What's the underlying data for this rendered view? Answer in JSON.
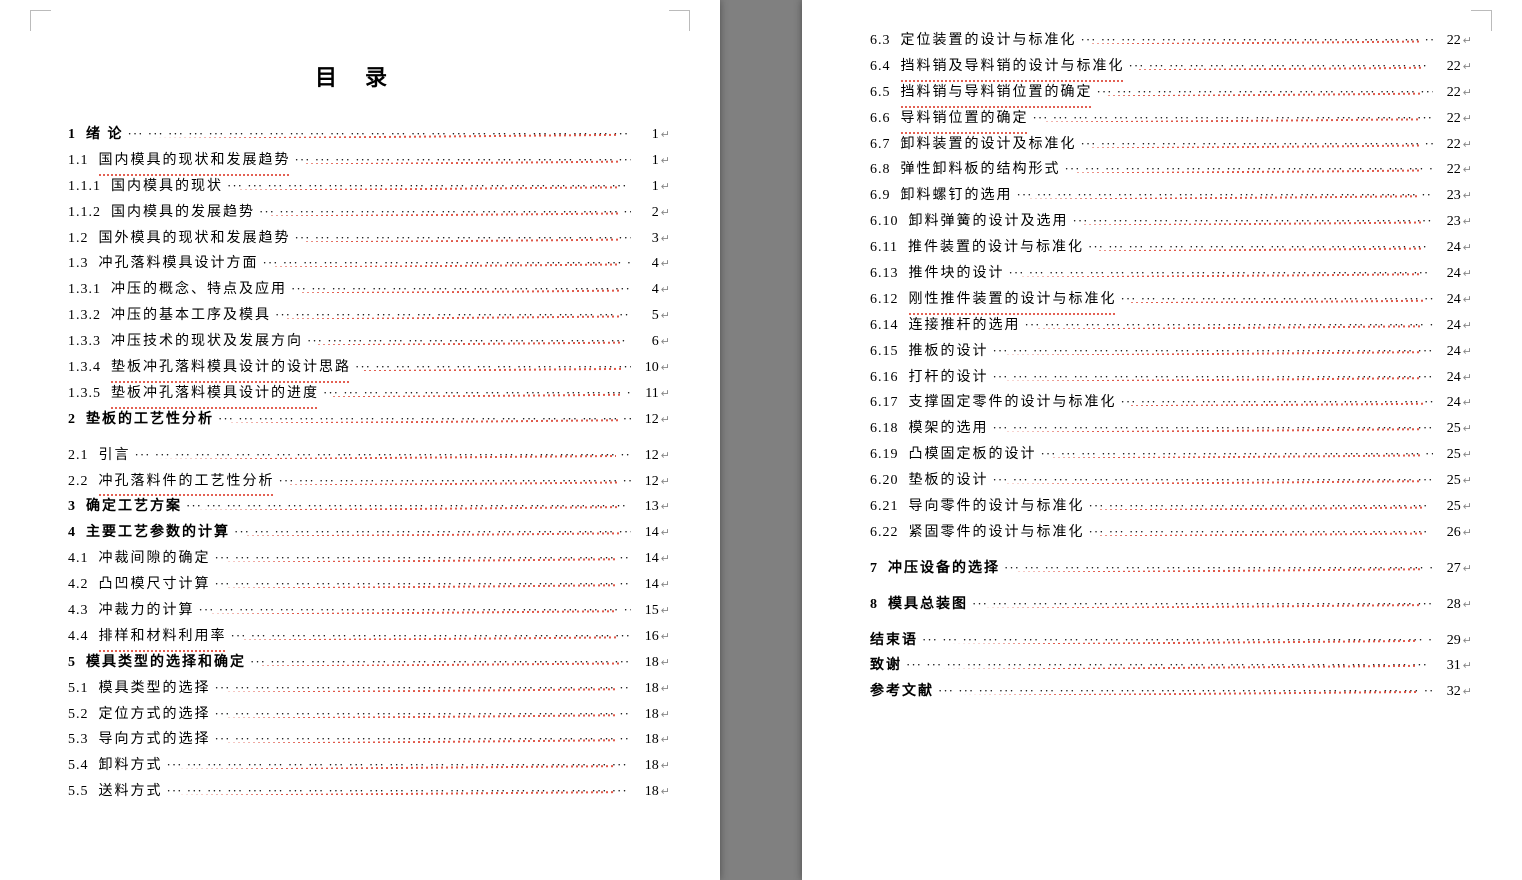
{
  "title": "目录",
  "left_entries": [
    {
      "num": "1",
      "txt": "绪 论",
      "pg": "1",
      "bold": true,
      "mark": false
    },
    {
      "num": "1.1",
      "txt": "国内模具的现状和发展趋势",
      "pg": "1",
      "bold": false,
      "mark": true
    },
    {
      "num": "1.1.1",
      "txt": "国内模具的现状",
      "pg": "1",
      "bold": false,
      "mark": false
    },
    {
      "num": "1.1.2",
      "txt": "国内模具的发展趋势",
      "pg": "2",
      "bold": false,
      "mark": false
    },
    {
      "num": "1.2",
      "txt": "国外模具的现状和发展趋势",
      "pg": "3",
      "bold": false,
      "mark": false
    },
    {
      "num": "1.3",
      "txt": "冲孔落料模具设计方面",
      "pg": "4",
      "bold": false,
      "mark": false
    },
    {
      "num": "1.3.1",
      "txt": "冲压的概念、特点及应用",
      "pg": "4",
      "bold": false,
      "mark": false
    },
    {
      "num": "1.3.2",
      "txt": "冲压的基本工序及模具",
      "pg": "5",
      "bold": false,
      "mark": false
    },
    {
      "num": "1.3.3",
      "txt": "冲压技术的现状及发展方向",
      "pg": "6",
      "bold": false,
      "mark": false
    },
    {
      "num": "1.3.4",
      "txt": "垫板冲孔落料模具设计的设计思路",
      "pg": "10",
      "bold": false,
      "mark": true
    },
    {
      "num": "1.3.5",
      "txt": "垫板冲孔落料模具设计的进度",
      "pg": "11",
      "bold": false,
      "mark": true
    },
    {
      "num": "2",
      "txt": "垫板的工艺性分析",
      "pg": "12",
      "bold": true,
      "mark": false,
      "spacer_after": true
    },
    {
      "num": "2.1",
      "txt": "引言",
      "pg": "12",
      "bold": false,
      "mark": false
    },
    {
      "num": "2.2",
      "txt": "冲孔落料件的工艺性分析",
      "pg": "12",
      "bold": false,
      "mark": true
    },
    {
      "num": "3",
      "txt": "确定工艺方案",
      "pg": "13",
      "bold": true,
      "mark": false
    },
    {
      "num": "4",
      "txt": "主要工艺参数的计算",
      "pg": "14",
      "bold": true,
      "mark": false
    },
    {
      "num": "4.1",
      "txt": "冲裁间隙的确定",
      "pg": "14",
      "bold": false,
      "mark": false
    },
    {
      "num": "4.2",
      "txt": "凸凹模尺寸计算",
      "pg": "14",
      "bold": false,
      "mark": false
    },
    {
      "num": "4.3",
      "txt": "冲裁力的计算",
      "pg": "15",
      "bold": false,
      "mark": false
    },
    {
      "num": "4.4",
      "txt": "排样和材料利用率",
      "pg": "16",
      "bold": false,
      "mark": true
    },
    {
      "num": "5",
      "txt": "模具类型的选择和确定",
      "pg": "18",
      "bold": true,
      "mark": false
    },
    {
      "num": "5.1",
      "txt": "模具类型的选择",
      "pg": "18",
      "bold": false,
      "mark": false
    },
    {
      "num": "5.2",
      "txt": "定位方式的选择",
      "pg": "18",
      "bold": false,
      "mark": false
    },
    {
      "num": "5.3",
      "txt": "导向方式的选择",
      "pg": "18",
      "bold": false,
      "mark": false
    },
    {
      "num": "5.4",
      "txt": "卸料方式",
      "pg": "18",
      "bold": false,
      "mark": false
    },
    {
      "num": "5.5",
      "txt": "送料方式",
      "pg": "18",
      "bold": false,
      "mark": false
    }
  ],
  "right_entries": [
    {
      "num": "6.3",
      "txt": "定位装置的设计与标准化",
      "pg": "22",
      "bold": false,
      "mark": false
    },
    {
      "num": "6.4",
      "txt": "挡料销及导料销的设计与标准化",
      "pg": "22",
      "bold": false,
      "mark": true
    },
    {
      "num": "6.5",
      "txt": "挡料销与导料销位置的确定",
      "pg": "22",
      "bold": false,
      "mark": true
    },
    {
      "num": "6.6",
      "txt": "导料销位置的确定",
      "pg": "22",
      "bold": false,
      "mark": true
    },
    {
      "num": "6.7",
      "txt": "卸料装置的设计及标准化",
      "pg": "22",
      "bold": false,
      "mark": false
    },
    {
      "num": "6.8",
      "txt": "弹性卸料板的结构形式",
      "pg": "22",
      "bold": false,
      "mark": false
    },
    {
      "num": "6.9",
      "txt": "卸料螺钉的选用",
      "pg": "23",
      "bold": false,
      "mark": false
    },
    {
      "num": "6.10",
      "txt": "卸料弹簧的设计及选用",
      "pg": "23",
      "bold": false,
      "mark": false
    },
    {
      "num": "6.11",
      "txt": "推件装置的设计与标准化",
      "pg": "24",
      "bold": false,
      "mark": false
    },
    {
      "num": "6.13",
      "txt": "推件块的设计",
      "pg": "24",
      "bold": false,
      "mark": false
    },
    {
      "num": "6.12",
      "txt": "刚性推件装置的设计与标准化",
      "pg": "24",
      "bold": false,
      "mark": true
    },
    {
      "num": "6.14",
      "txt": "连接推杆的选用",
      "pg": "24",
      "bold": false,
      "mark": false
    },
    {
      "num": "6.15",
      "txt": "推板的设计",
      "pg": "24",
      "bold": false,
      "mark": false
    },
    {
      "num": "6.16",
      "txt": "打杆的设计",
      "pg": "24",
      "bold": false,
      "mark": false
    },
    {
      "num": "6.17",
      "txt": "支撑固定零件的设计与标准化",
      "pg": "24",
      "bold": false,
      "mark": false
    },
    {
      "num": "6.18",
      "txt": "模架的选用",
      "pg": "25",
      "bold": false,
      "mark": false
    },
    {
      "num": "6.19",
      "txt": "凸模固定板的设计",
      "pg": "25",
      "bold": false,
      "mark": false
    },
    {
      "num": "6.20",
      "txt": "垫板的设计",
      "pg": "25",
      "bold": false,
      "mark": false
    },
    {
      "num": "6.21",
      "txt": "导向零件的设计与标准化",
      "pg": "25",
      "bold": false,
      "mark": false
    },
    {
      "num": "6.22",
      "txt": "紧固零件的设计与标准化",
      "pg": "26",
      "bold": false,
      "mark": false,
      "spacer_after": true
    },
    {
      "num": "7",
      "txt": "冲压设备的选择",
      "pg": "27",
      "bold": true,
      "mark": false,
      "spacer_after": true
    },
    {
      "num": "8",
      "txt": "模具总装图",
      "pg": "28",
      "bold": true,
      "mark": false,
      "spacer_after": true
    },
    {
      "num": "",
      "txt": "结束语",
      "pg": "29",
      "bold": true,
      "mark": false
    },
    {
      "num": "",
      "txt": "致谢",
      "pg": "31",
      "bold": true,
      "mark": false
    },
    {
      "num": "",
      "txt": "参考文献",
      "pg": "32",
      "bold": true,
      "mark": false
    }
  ]
}
